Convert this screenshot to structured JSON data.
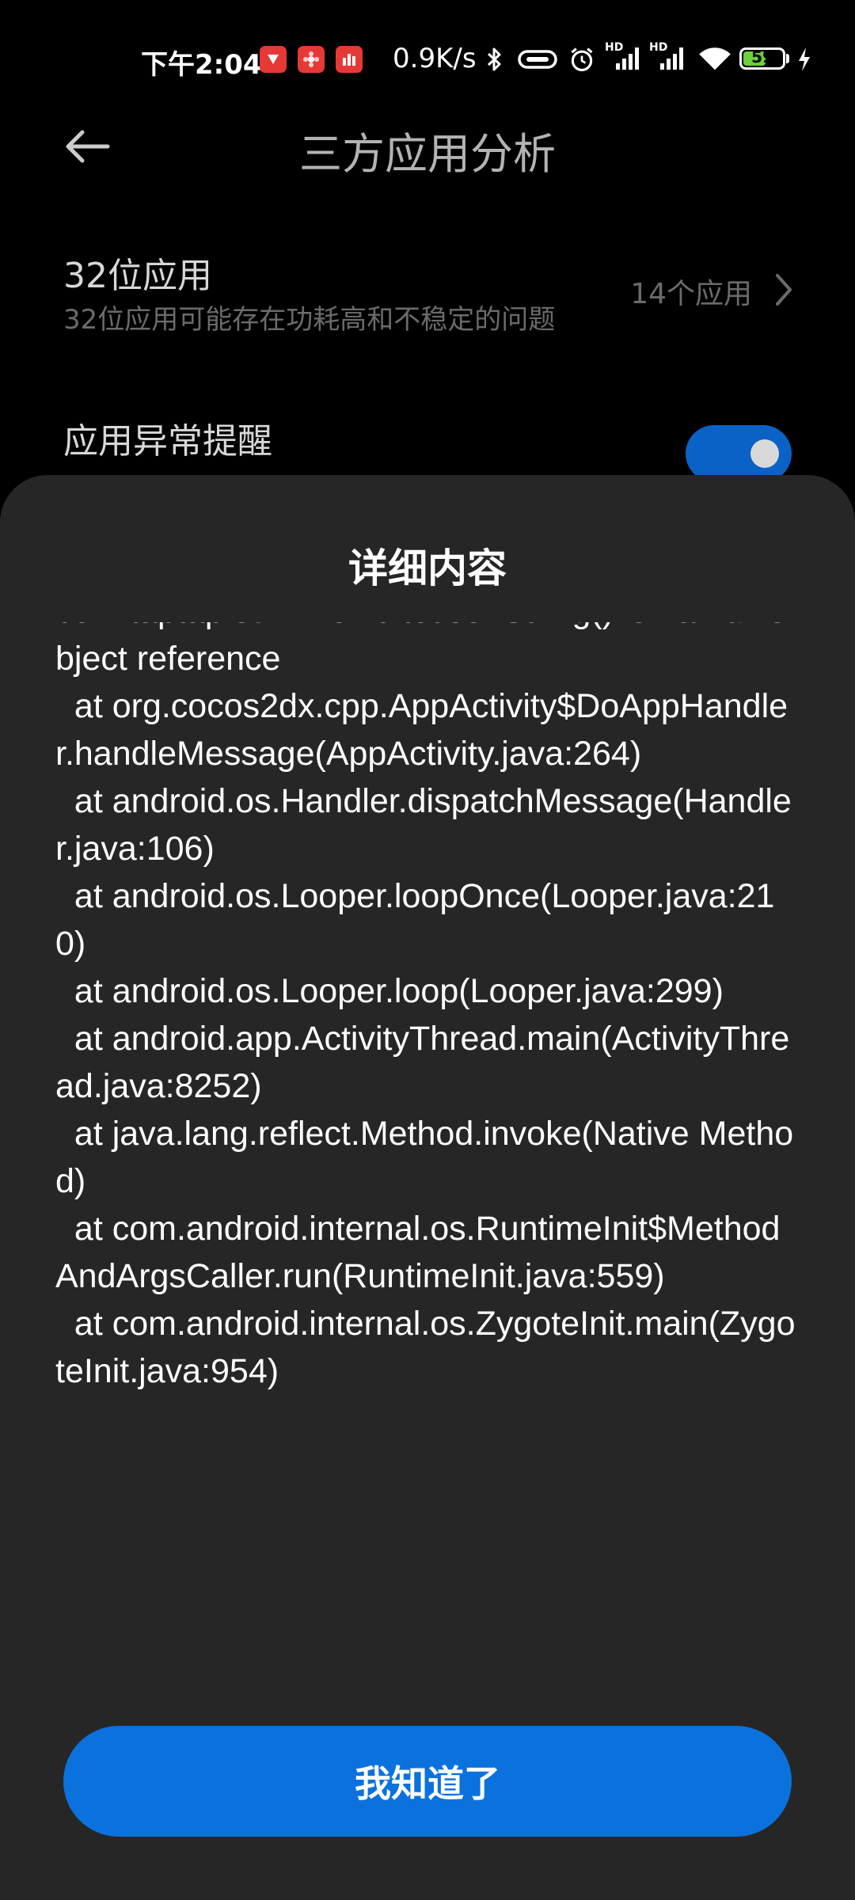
{
  "status_bar": {
    "time": "下午2:04",
    "net_speed": "0.9K/s",
    "battery_level": "59",
    "battery_fraction": 0.59,
    "notification_icons": [
      "app-notification-icon",
      "flower-app-icon",
      "chart-app-icon"
    ],
    "icons": [
      "bluetooth-icon",
      "vibrate-icon",
      "alarm-icon",
      "hd-signal-icon",
      "hd-signal-icon",
      "wifi-icon",
      "battery-icon",
      "charging-icon"
    ],
    "network_label_1": "HD",
    "network_label_2": "HD"
  },
  "header": {
    "title": "三方应用分析",
    "back_icon": "back-arrow-icon"
  },
  "settings": {
    "row_32bit": {
      "title": "32位应用",
      "subtitle": "32位应用可能存在功耗高和不稳定的问题",
      "value": "14个应用",
      "icon": "chevron-right-icon"
    },
    "row_abnormal": {
      "title": "应用异常提醒",
      "toggle_on": true
    }
  },
  "sheet": {
    "title": "详细内容",
    "detail_text": "com.taptap.sdk.Profile.toJsonString()' on a null object reference\n  at org.cocos2dx.cpp.AppActivity$DoAppHandler.handleMessage(AppActivity.java:264)\n  at android.os.Handler.dispatchMessage(Handler.java:106)\n  at android.os.Looper.loopOnce(Looper.java:210)\n  at android.os.Looper.loop(Looper.java:299)\n  at android.app.ActivityThread.main(ActivityThread.java:8252)\n  at java.lang.reflect.Method.invoke(Native Method)\n  at com.android.internal.os.RuntimeInit$MethodAndArgsCaller.run(RuntimeInit.java:559)\n  at com.android.internal.os.ZygoteInit.main(ZygoteInit.java:954)",
    "confirm_label": "我知道了"
  },
  "colors": {
    "background": "#000000",
    "sheet": "#262626",
    "accent": "#0b72dd",
    "toggle": "#0a62c7",
    "battery": "#6ccf3d"
  }
}
